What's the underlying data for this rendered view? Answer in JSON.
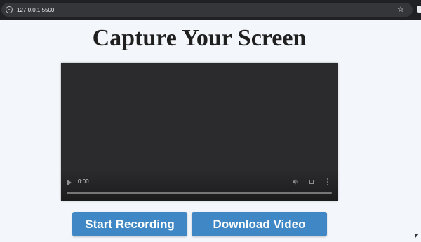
{
  "browser": {
    "url": "127.0.0.1:5500",
    "icons": [
      "info-icon",
      "star-icon",
      "profile-icon"
    ]
  },
  "page": {
    "title": "Capture Your Screen"
  },
  "video": {
    "time": "0:00",
    "icons": [
      "play-icon",
      "volume-icon",
      "fullscreen-icon",
      "more-icon"
    ]
  },
  "buttons": {
    "start_label": "Start Recording",
    "download_label": "Download Video"
  },
  "colors": {
    "button": "#3f88c5",
    "background": "#f3f6fa",
    "video": "#2b2a2c"
  }
}
